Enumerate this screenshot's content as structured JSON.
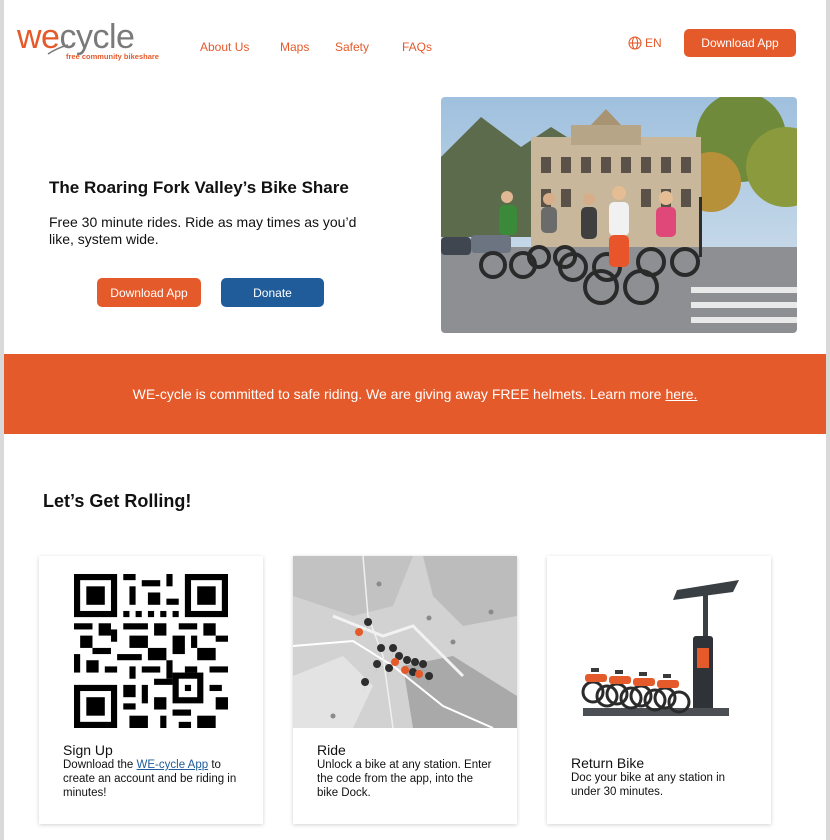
{
  "header": {
    "logo": {
      "brand_we": "we",
      "brand_cycle": "cycle",
      "tagline": "free community bikeshare"
    },
    "nav": [
      "About Us",
      "Maps",
      "Safety",
      "FAQs"
    ],
    "language": {
      "icon": "globe-icon",
      "code": "EN"
    },
    "download_label": "Download App"
  },
  "hero": {
    "title": "The Roaring Fork Valley’s Bike Share",
    "subtitle": "Free 30 minute rides. Ride as may times as you’d like, system wide.",
    "download_label": "Download App",
    "donate_label": "Donate",
    "photo": "photo of four cyclists riding WE-cycle bikes on a street"
  },
  "banner": {
    "text": "WE-cycle is committed to safe riding. We are giving away FREE helmets. Learn more",
    "link_text": "here."
  },
  "section": {
    "title": "Let’s Get Rolling!"
  },
  "cards": [
    {
      "title": "Sign Up",
      "text_before": "Download the",
      "link_text": "WE-cycle App",
      "text_after": "to create an account and be riding in minutes!",
      "image": "qr-code"
    },
    {
      "title": "Ride",
      "text": "Unlock a bike at any station. Enter the code from the app, into the bike Dock.",
      "image": "station-map"
    },
    {
      "title": "Return Bike",
      "text": "Doc your bike at any station in under 30 minutes.",
      "image": "bike-dock-station"
    }
  ],
  "colors": {
    "accent": "#e55a2b",
    "secondary": "#1f5c99"
  }
}
